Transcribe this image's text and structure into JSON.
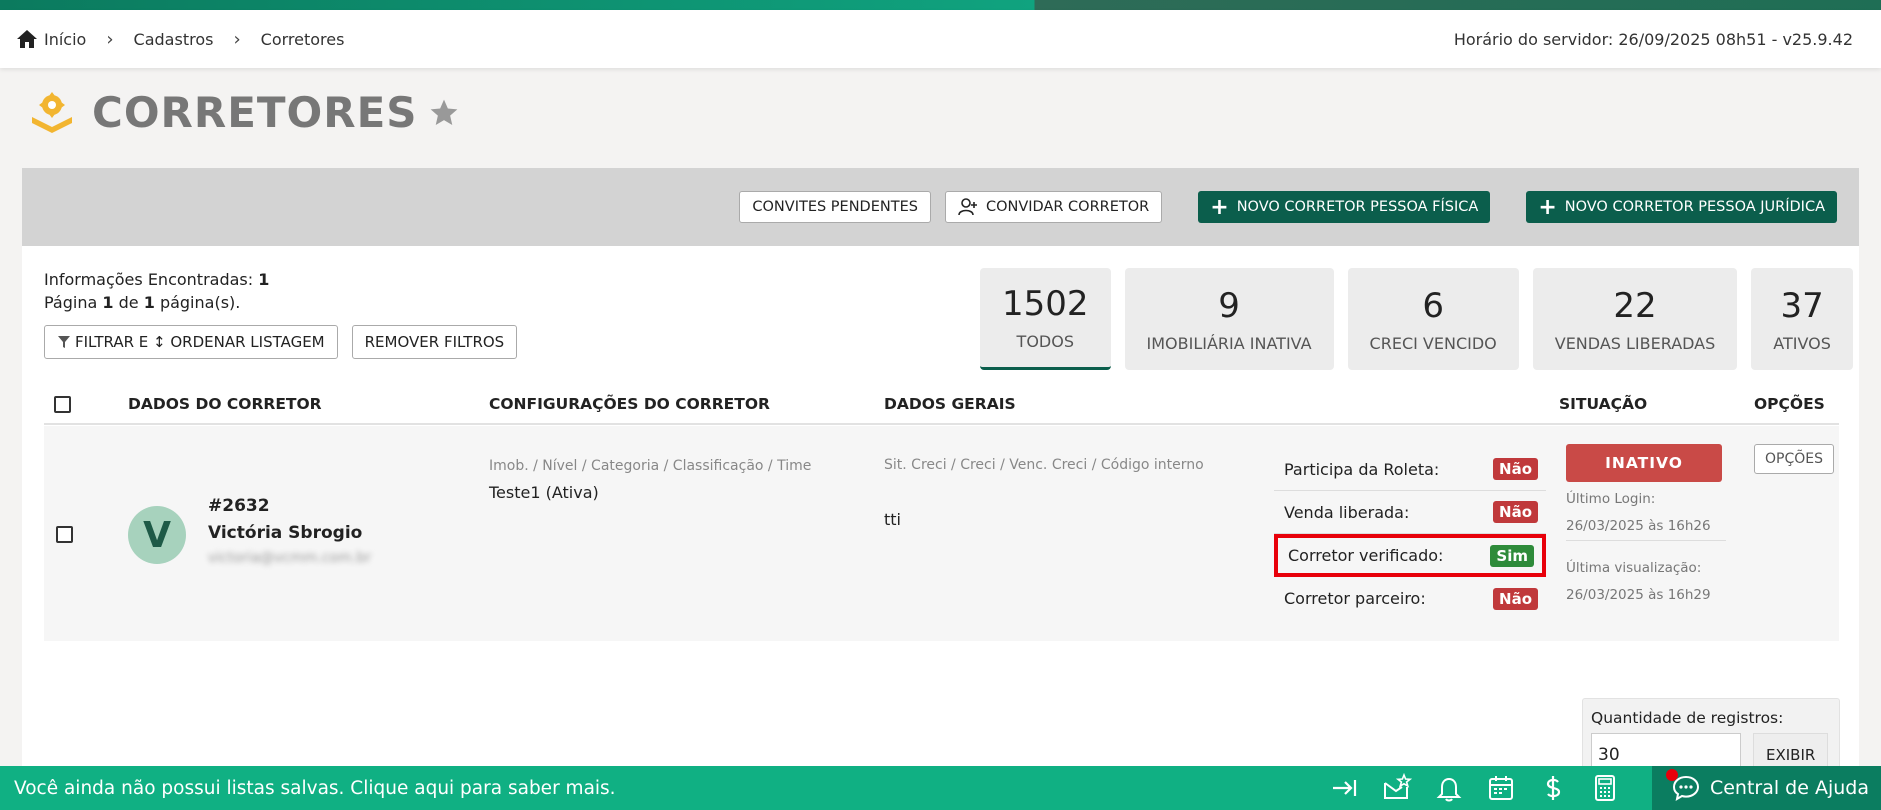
{
  "breadcrumb": {
    "home": "Início",
    "item1": "Cadastros",
    "item2": "Corretores"
  },
  "server_time": "Horário do servidor: 26/09/2025 08h51 - v25.9.42",
  "page": {
    "title": "CORRETORES"
  },
  "actions": {
    "pending_invites": "CONVITES PENDENTES",
    "invite": "CONVIDAR CORRETOR",
    "new_pf": "NOVO CORRETOR PESSOA FÍSICA",
    "new_pj": "NOVO CORRETOR PESSOA JURÍDICA"
  },
  "info": {
    "found_label": "Informações Encontradas:",
    "found_count": "1",
    "page_label": "Página",
    "page_num": "1",
    "page_of": "de",
    "page_total": "1",
    "page_suffix": "página(s)."
  },
  "filters": {
    "filter": "FILTRAR E ↕ ORDENAR LISTAGEM",
    "remove": "REMOVER FILTROS"
  },
  "stats": [
    {
      "num": "1502",
      "label": "TODOS"
    },
    {
      "num": "9",
      "label": "IMOBILIÁRIA INATIVA"
    },
    {
      "num": "6",
      "label": "CRECI VENCIDO"
    },
    {
      "num": "22",
      "label": "VENDAS LIBERADAS"
    },
    {
      "num": "37",
      "label": "ATIVOS"
    }
  ],
  "table": {
    "headers": {
      "dados": "DADOS DO CORRETOR",
      "config": "CONFIGURAÇÕES DO CORRETOR",
      "gerais": "DADOS GERAIS",
      "situacao": "SITUAÇÃO",
      "opcoes": "OPÇÕES"
    },
    "row": {
      "avatar_letter": "V",
      "id": "#2632",
      "name": "Victória Sbrogio",
      "email": "victoria@vcmm.com.br",
      "config_label": "Imob. / Nível / Categoria / Classificação / Time",
      "config_value": "Teste1 (Ativa)",
      "gerais_label": "Sit. Creci / Creci / Venc. Creci / Código interno",
      "gerais_value": "tti",
      "flags": [
        {
          "label": "Participa da Roleta:",
          "value": "Não"
        },
        {
          "label": "Venda liberada:",
          "value": "Não"
        },
        {
          "label": "Corretor verificado:",
          "value": "Sim"
        },
        {
          "label": "Corretor parceiro:",
          "value": "Não"
        }
      ],
      "status": "INATIVO",
      "last_login_label": "Último Login:",
      "last_login": "26/03/2025 às 16h26",
      "last_view_label": "Última visualização:",
      "last_view": "26/03/2025 às 16h29",
      "options": "OPÇÕES"
    }
  },
  "pagination": {
    "label": "Quantidade de registros:",
    "value": "30",
    "button": "EXIBIR"
  },
  "footer": {
    "message": "Você ainda não possui listas salvas. Clique aqui para saber mais.",
    "help": "Central de Ajuda"
  },
  "colors": {
    "brand_green": "#0b5e4c",
    "footer_green": "#10b083",
    "danger": "#c94a47",
    "success": "#2e8b3a"
  }
}
